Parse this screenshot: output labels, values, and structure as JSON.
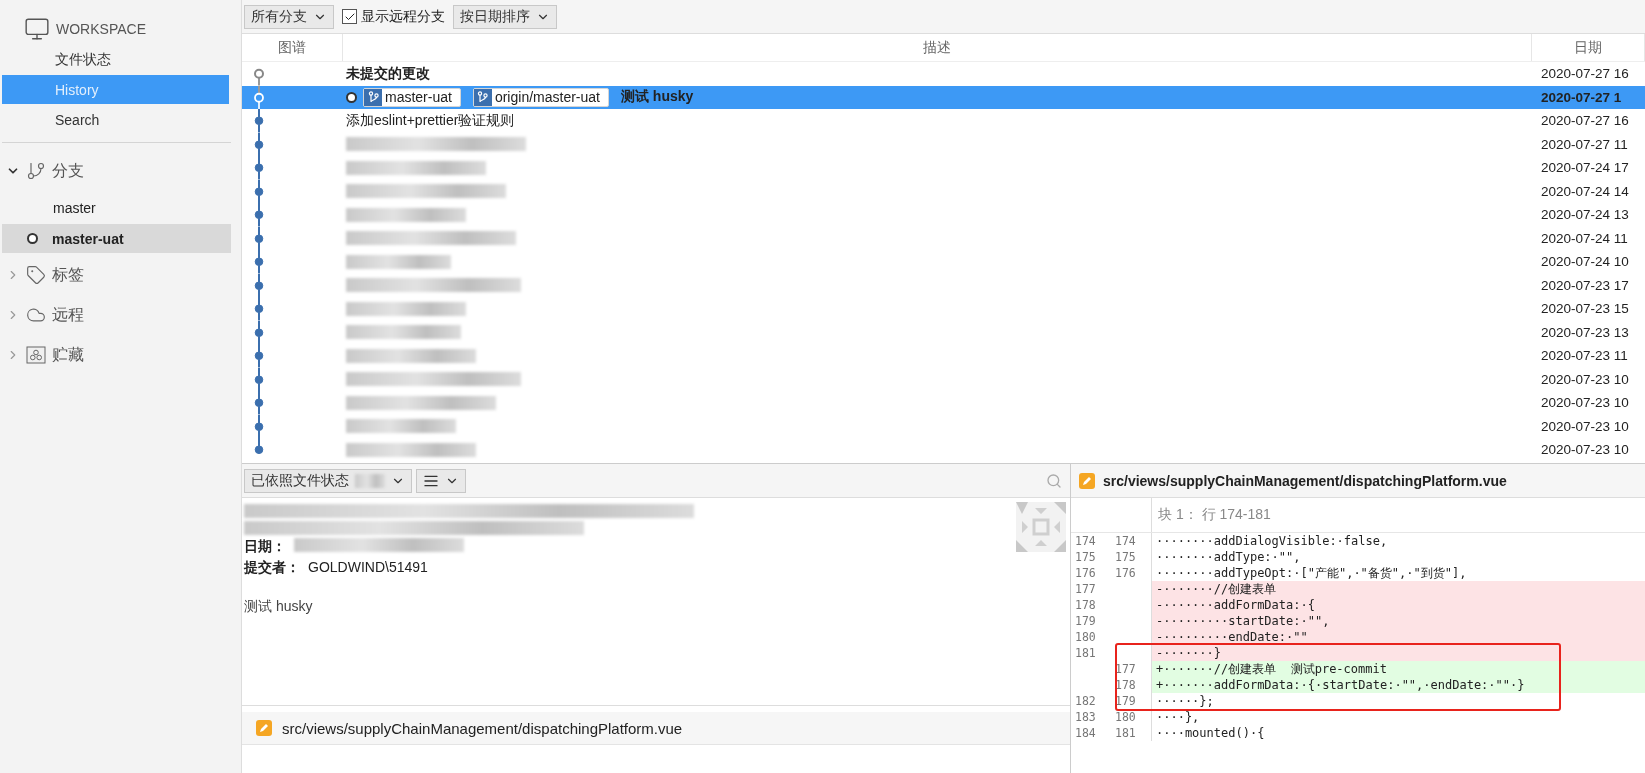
{
  "sidebar": {
    "workspace": {
      "title": "WORKSPACE",
      "items": [
        {
          "label": "文件状态",
          "selected": false
        },
        {
          "label": "History",
          "selected": true
        },
        {
          "label": "Search",
          "selected": false
        }
      ]
    },
    "sections": [
      {
        "kind": "branch",
        "label": "分支",
        "expanded": true,
        "items": [
          {
            "label": "master",
            "current": false
          },
          {
            "label": "master-uat",
            "current": true
          }
        ]
      },
      {
        "kind": "tag",
        "label": "标签",
        "expanded": false
      },
      {
        "kind": "remote",
        "label": "远程",
        "expanded": false
      },
      {
        "kind": "stash",
        "label": "贮藏",
        "expanded": false
      }
    ]
  },
  "toolbar": {
    "branch_filter": "所有分支",
    "show_remote": {
      "label": "显示远程分支",
      "checked": true
    },
    "sort": "按日期排序"
  },
  "history": {
    "columns": [
      "图谱",
      "描述",
      "日期"
    ],
    "rows": [
      {
        "kind": "uncommitted",
        "description": "未提交的更改",
        "date": "2020-07-27 16",
        "selected": false
      },
      {
        "kind": "commit",
        "head": true,
        "refs": [
          "master-uat",
          "origin/master-uat"
        ],
        "description": "测试 husky",
        "date": "2020-07-27 1",
        "selected": true
      },
      {
        "kind": "commit",
        "description": "添加eslint+prettier验证规则",
        "date": "2020-07-27 16",
        "selected": false
      },
      {
        "kind": "redacted",
        "date": "2020-07-27 11",
        "selected": false
      },
      {
        "kind": "redacted",
        "date": "2020-07-24 17",
        "selected": false
      },
      {
        "kind": "redacted",
        "date": "2020-07-24 14",
        "selected": false
      },
      {
        "kind": "redacted",
        "date": "2020-07-24 13",
        "selected": false
      },
      {
        "kind": "redacted",
        "date": "2020-07-24 11",
        "selected": false
      },
      {
        "kind": "redacted",
        "date": "2020-07-24 10",
        "selected": false
      },
      {
        "kind": "redacted",
        "date": "2020-07-23 17",
        "selected": false
      },
      {
        "kind": "redacted",
        "date": "2020-07-23 15",
        "selected": false
      },
      {
        "kind": "redacted",
        "date": "2020-07-23 13",
        "selected": false
      },
      {
        "kind": "redacted",
        "date": "2020-07-23 11",
        "selected": false
      },
      {
        "kind": "redacted",
        "date": "2020-07-23 10",
        "selected": false
      },
      {
        "kind": "redacted",
        "date": "2020-07-23 10",
        "selected": false
      },
      {
        "kind": "redacted",
        "date": "2020-07-23 10",
        "selected": false
      },
      {
        "kind": "redacted",
        "date": "2020-07-23 10",
        "selected": false
      }
    ]
  },
  "details": {
    "file_filter": "已依照文件状态",
    "fields": [
      {
        "label": "日期："
      },
      {
        "label": "提交者：",
        "value": "GOLDWIND\\51491"
      }
    ],
    "message": "测试 husky",
    "files": [
      "src/views/supplyChainManagement/dispatchingPlatform.vue"
    ]
  },
  "diff": {
    "file": "src/views/supplyChainManagement/dispatchingPlatform.vue",
    "hunk": "块 1： 行 174-181",
    "lines": [
      {
        "kind": "context",
        "old": "174",
        "new": "174",
        "text": "········addDialogVisible:·false,",
        "boxed": false
      },
      {
        "kind": "context",
        "old": "175",
        "new": "175",
        "text": "········addType:·\"\",",
        "boxed": false
      },
      {
        "kind": "context",
        "old": "176",
        "new": "176",
        "text": "········addTypeOpt:·[\"产能\",·\"备货\",·\"到货\"],",
        "boxed": false
      },
      {
        "kind": "removed",
        "old": "177",
        "text": "-·······//创建表单",
        "boxed": false
      },
      {
        "kind": "removed",
        "old": "178",
        "text": "-·······addFormData:·{",
        "boxed": false
      },
      {
        "kind": "removed",
        "old": "179",
        "text": "-·········startDate:·\"\",",
        "boxed": false
      },
      {
        "kind": "removed",
        "old": "180",
        "text": "-·········endDate:·\"\"",
        "boxed": false
      },
      {
        "kind": "removed",
        "old": "181",
        "text": "-·······}",
        "boxed": true
      },
      {
        "kind": "added",
        "new": "177",
        "text": "+·······//创建表单  测试pre-commit",
        "boxed": true
      },
      {
        "kind": "added",
        "new": "178",
        "text": "+·······addFormData:·{·startDate:·\"\",·endDate:·\"\"·}",
        "boxed": true
      },
      {
        "kind": "context",
        "old": "182",
        "new": "179",
        "text": "······};",
        "boxed": true
      },
      {
        "kind": "context",
        "old": "183",
        "new": "180",
        "text": "····},",
        "boxed": false
      },
      {
        "kind": "context",
        "old": "184",
        "new": "181",
        "text": "····mounted()·{",
        "boxed": false
      }
    ]
  }
}
